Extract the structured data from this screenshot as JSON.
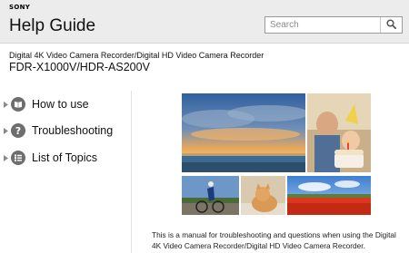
{
  "header": {
    "brand": "SONY",
    "title": "Help Guide",
    "search_placeholder": "Search",
    "search_icon": "magnifier-icon"
  },
  "product": {
    "subtitle": "Digital 4K Video Camera Recorder/Digital HD Video Camera Recorder",
    "model": "FDR-X1000V/HDR-AS200V"
  },
  "nav": {
    "items": [
      {
        "label": "How to use",
        "icon": "book-icon"
      },
      {
        "label": "Troubleshooting",
        "icon": "question-icon",
        "glyph": "?"
      },
      {
        "label": "List of Topics",
        "icon": "list-icon"
      }
    ]
  },
  "content": {
    "description": "This is a manual for troubleshooting and questions when using the Digital 4K Video Camera Recorder/Digital HD Video Camera Recorder."
  },
  "colors": {
    "header_bg": "#ececec",
    "nav_icon": "#6e6e6e"
  }
}
